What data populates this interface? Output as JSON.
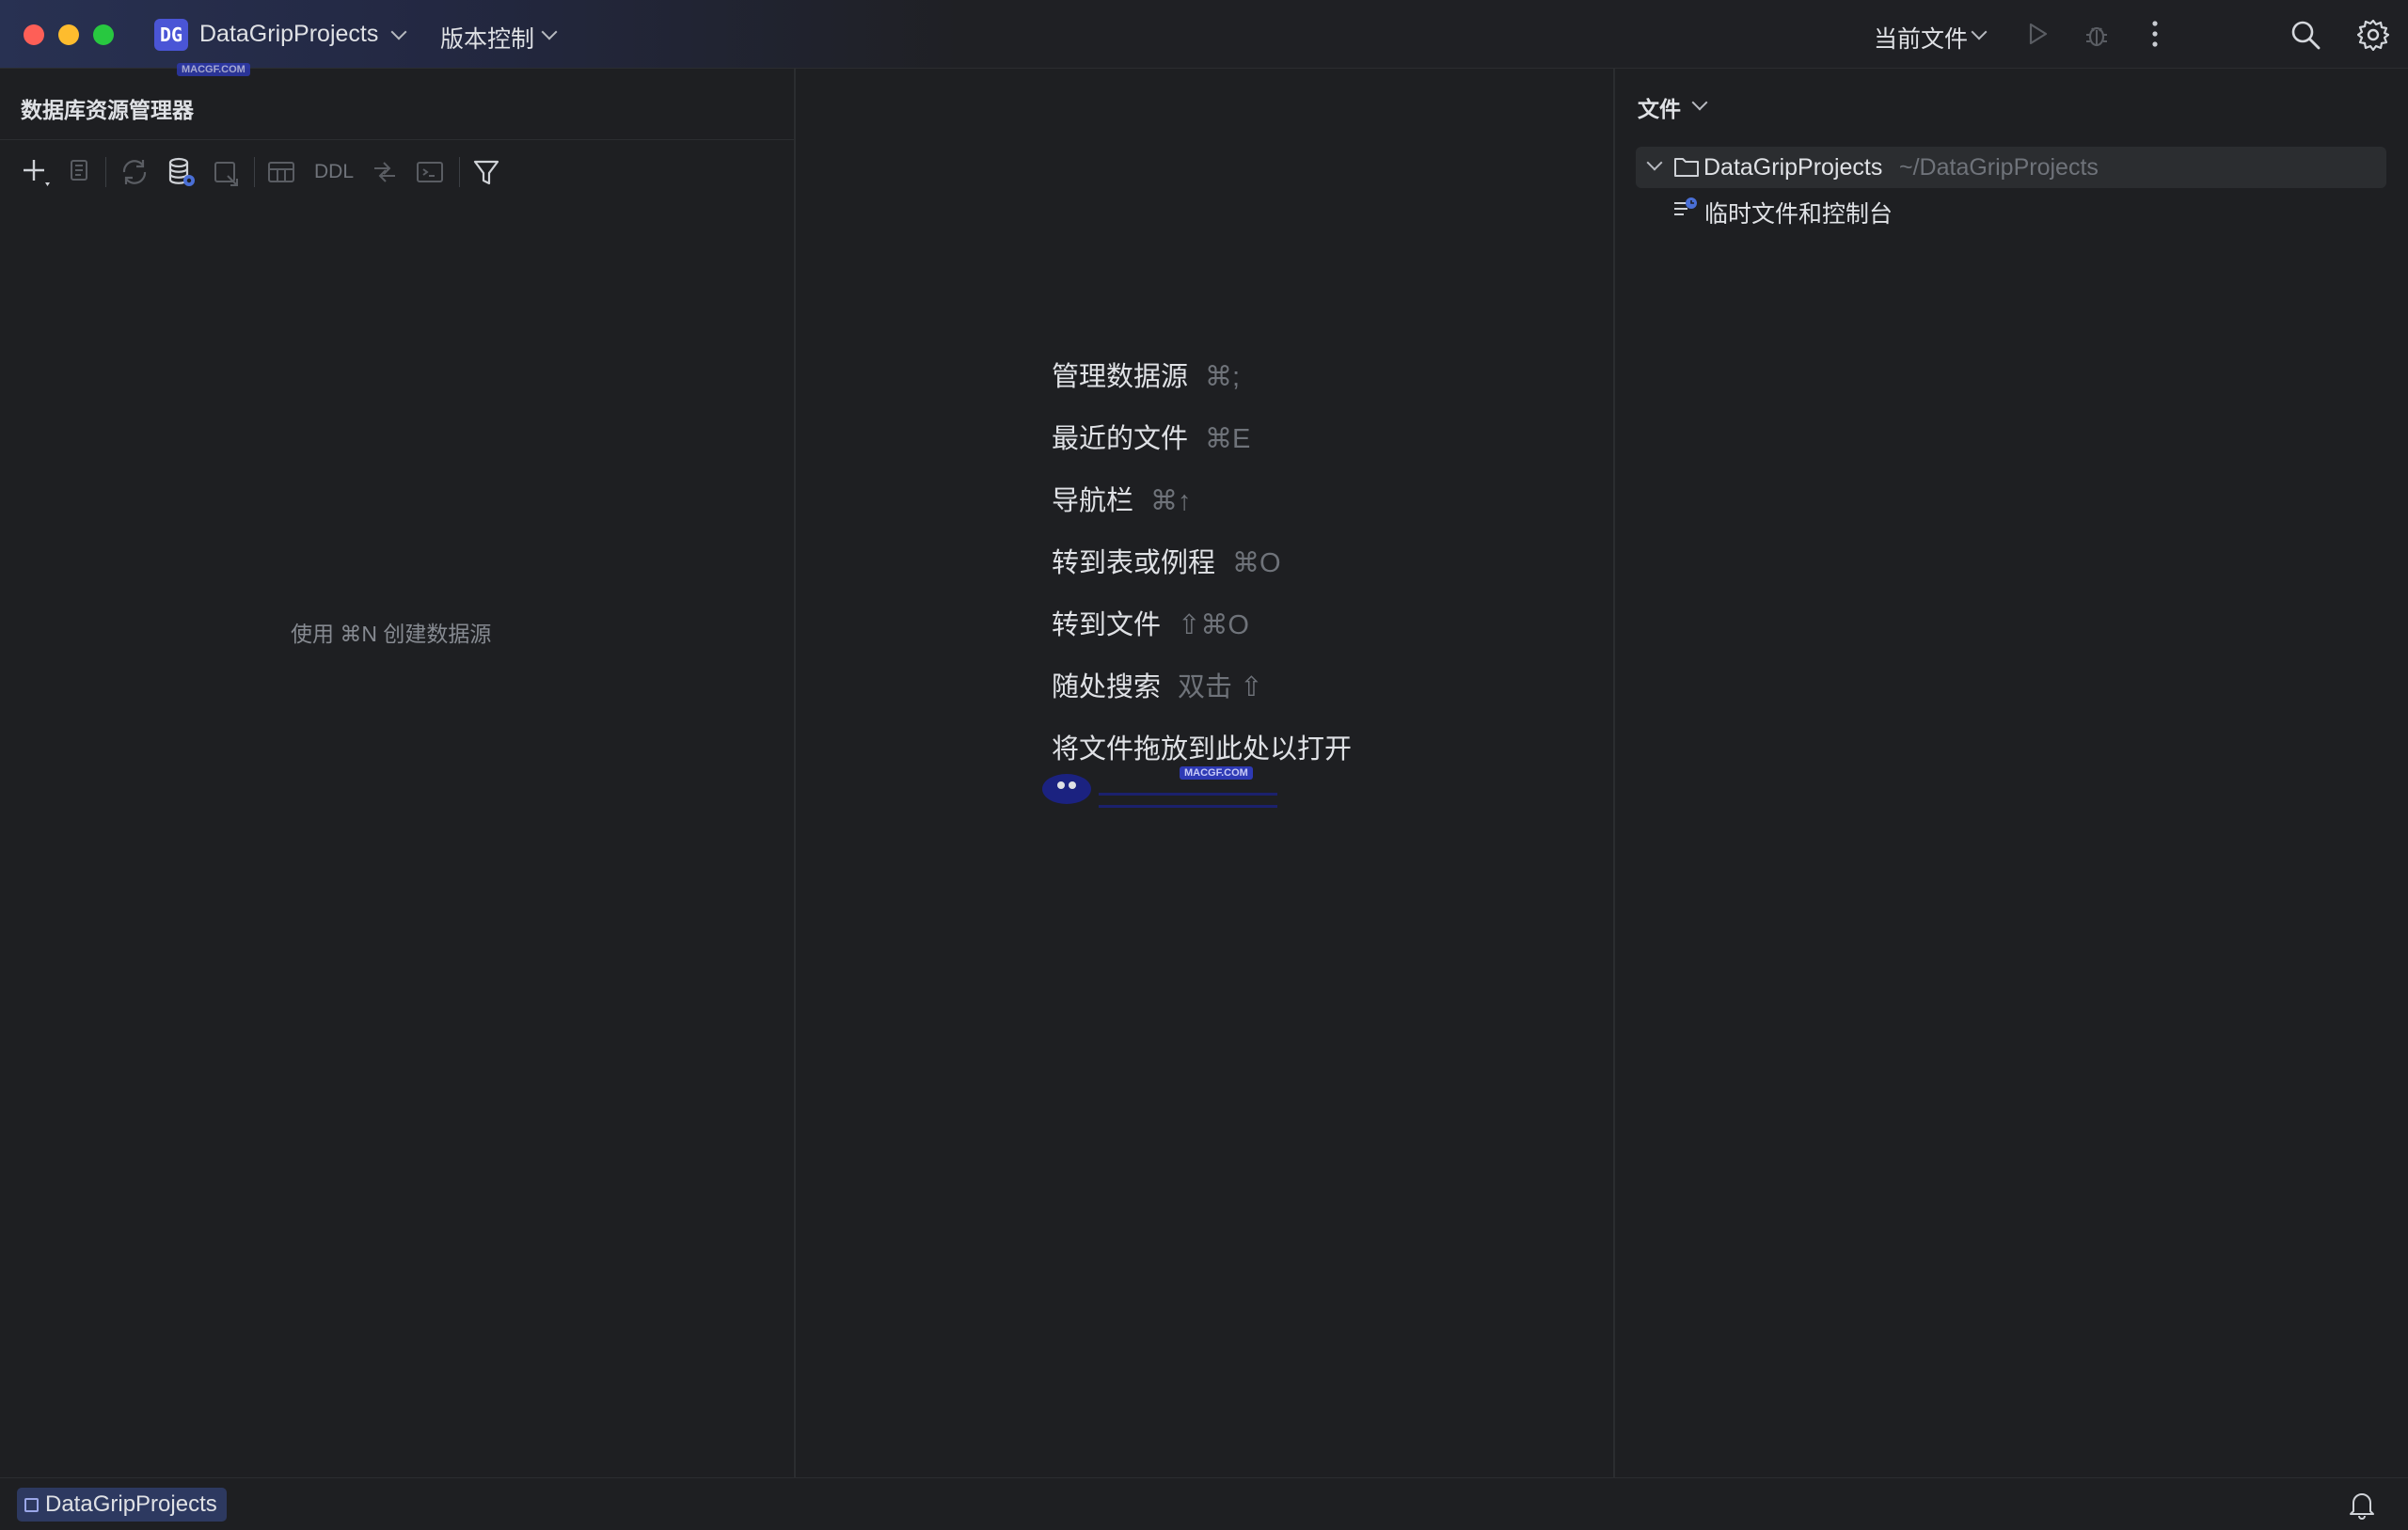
{
  "titlebar": {
    "project_badge": "DG",
    "project_name": "DataGripProjects",
    "vcs_label": "版本控制",
    "run_config": "当前文件"
  },
  "left_panel": {
    "title": "数据库资源管理器",
    "ddl_label": "DDL",
    "empty_hint": "使用 ⌘N 创建数据源"
  },
  "center": {
    "actions": [
      {
        "label": "管理数据源",
        "shortcut": "⌘;"
      },
      {
        "label": "最近的文件",
        "shortcut": "⌘E"
      },
      {
        "label": "导航栏",
        "shortcut": "⌘↑"
      },
      {
        "label": "转到表或例程",
        "shortcut": "⌘O"
      },
      {
        "label": "转到文件",
        "shortcut": "⇧⌘O"
      },
      {
        "label": "随处搜索",
        "shortcut": "双击 ⇧"
      }
    ],
    "drop_hint": "将文件拖放到此处以打开",
    "watermark": "MACGF.COM"
  },
  "right_panel": {
    "title": "文件",
    "tree": [
      {
        "label": "DataGripProjects",
        "path": "~/DataGripProjects"
      },
      {
        "label": "临时文件和控制台"
      }
    ]
  },
  "statusbar": {
    "project_name": "DataGripProjects"
  },
  "colors": {
    "accent": "#4a55d6",
    "background": "#1e1f22",
    "selection": "#2b2d30"
  }
}
